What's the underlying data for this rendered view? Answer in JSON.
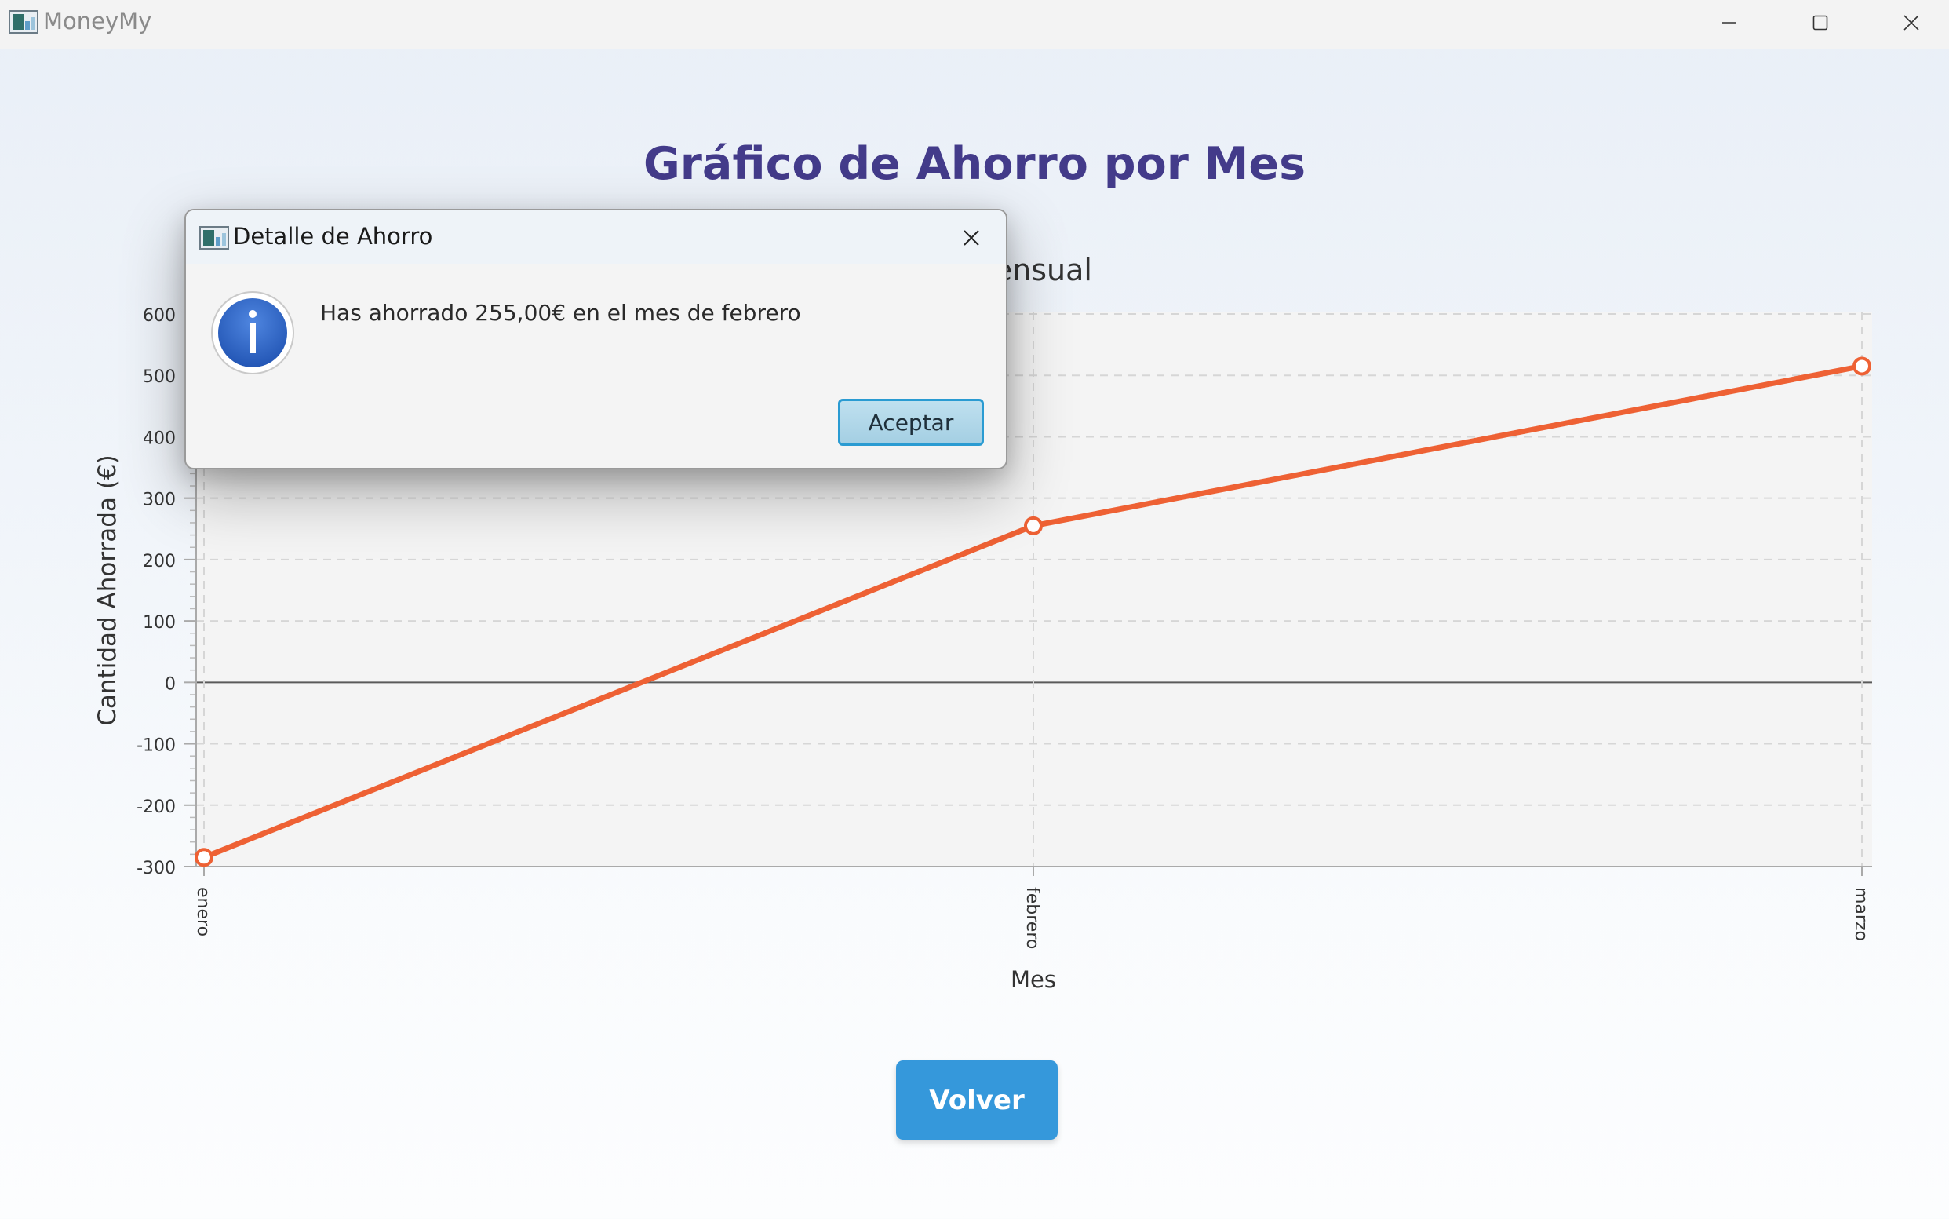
{
  "window": {
    "title": "MoneyMy"
  },
  "page": {
    "title": "Gráfico de Ahorro por Mes",
    "back_button": "Volver"
  },
  "chart_data": {
    "type": "line",
    "title_visible_fragment": "ensual",
    "xlabel": "Mes",
    "ylabel": "Cantidad Ahorrada (€)",
    "categories": [
      "enero",
      "febrero",
      "marzo"
    ],
    "values": [
      -285,
      255,
      515
    ],
    "ylim": [
      -300,
      600
    ],
    "yticks": [
      -300,
      -200,
      -100,
      0,
      100,
      200,
      300,
      400,
      500,
      600
    ],
    "grid": true,
    "series_color": "#ee6134"
  },
  "dialog": {
    "title": "Detalle de Ahorro",
    "message": "Has ahorrado 255,00€ en el mes de febrero",
    "ok_label": "Aceptar"
  },
  "icons": {
    "app": "app-icon",
    "info": "info-icon",
    "close": "close-icon"
  }
}
